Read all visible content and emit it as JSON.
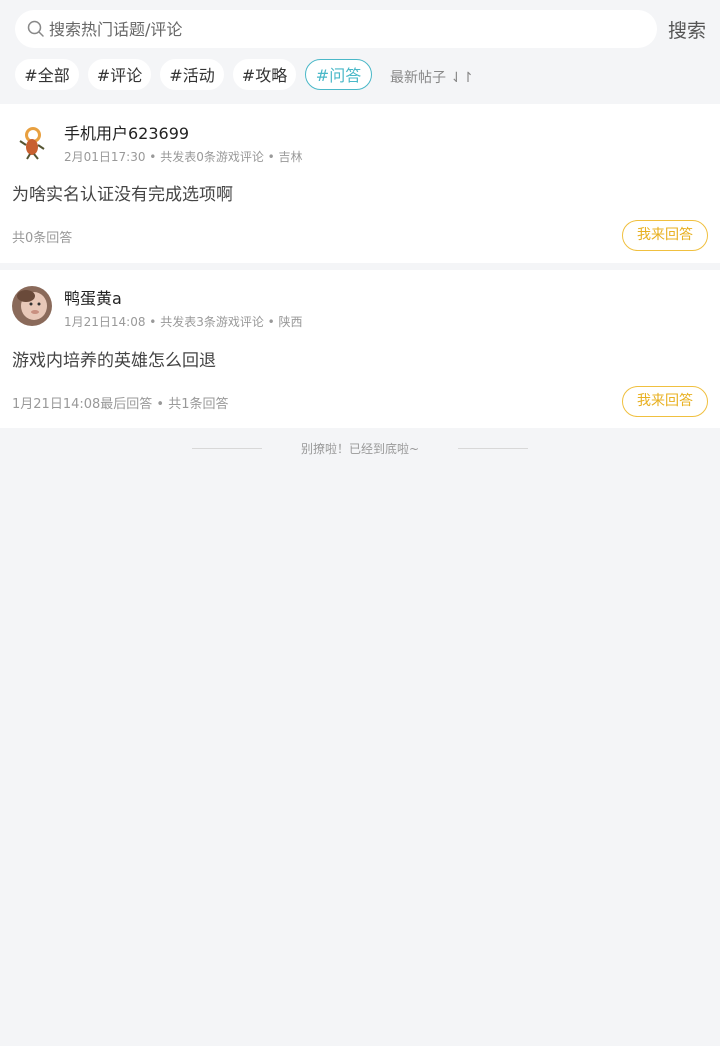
{
  "search": {
    "placeholder": "搜索热门话题/评论",
    "button_label": "搜索"
  },
  "tags": [
    {
      "label": "#全部"
    },
    {
      "label": "#评论"
    },
    {
      "label": "#活动"
    },
    {
      "label": "#攻略"
    },
    {
      "label": "#问答",
      "active": true
    }
  ],
  "sort": {
    "label": "最新帖子 ⇃↾"
  },
  "posts": [
    {
      "username": "手机用户623699",
      "meta": "2月01日17:30 • 共发表0条游戏评论 • 吉林",
      "title": "为啥实名认证没有完成选项啊",
      "stat": "共0条回答",
      "answer_label": "我来回答"
    },
    {
      "username": "鸭蛋黄a",
      "meta": "1月21日14:08 • 共发表3条游戏评论 • 陕西",
      "title": "游戏内培养的英雄怎么回退",
      "stat": "1月21日14:08最后回答 • 共1条回答",
      "answer_label": "我来回答"
    }
  ],
  "footer": {
    "text": "别撩啦！已经到底啦~"
  },
  "colors": {
    "accent": "#4ab8c8",
    "answer": "#e8b020",
    "background": "#f4f5f7"
  }
}
